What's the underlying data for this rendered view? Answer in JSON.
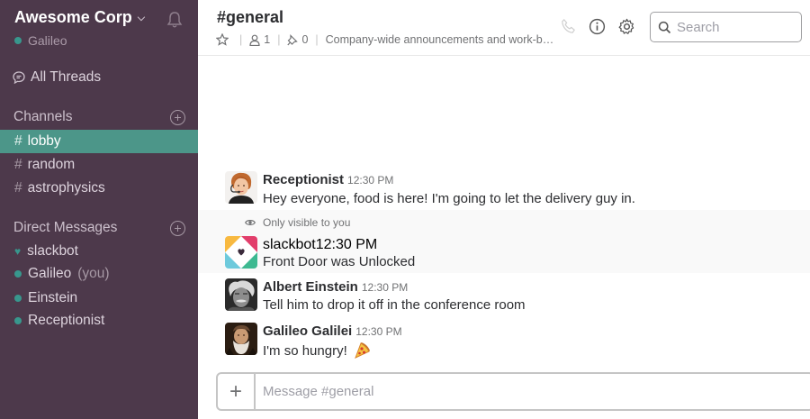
{
  "sidebar": {
    "team_name": "Awesome Corp",
    "current_user": "Galileo",
    "all_threads": "All Threads",
    "channels_header": "Channels",
    "channels": [
      {
        "name": "lobby",
        "active": true
      },
      {
        "name": "random",
        "active": false
      },
      {
        "name": "astrophysics",
        "active": false
      }
    ],
    "dm_header": "Direct Messages",
    "dms": [
      {
        "name": "slackbot",
        "suffix": "",
        "status": "heart"
      },
      {
        "name": "Galileo",
        "suffix": "(you)",
        "status": "online"
      },
      {
        "name": "Einstein",
        "suffix": "",
        "status": "online"
      },
      {
        "name": "Receptionist",
        "suffix": "",
        "status": "online"
      }
    ]
  },
  "header": {
    "channel": "#general",
    "members": "1",
    "pins": "0",
    "topic": "Company-wide announcements and work-b…",
    "search_placeholder": "Search"
  },
  "messages": [
    {
      "author": "Receptionist",
      "time": "12:30 PM",
      "text": "Hey everyone, food is here! I'm going to let the delivery guy in."
    },
    {
      "author": "slackbot",
      "time": "12:30 PM",
      "text": "Front Door was Unlocked",
      "note": "Only visible to you"
    },
    {
      "author": "Albert Einstein",
      "time": "12:30 PM",
      "text": "Tell him to drop it off in the conference room"
    },
    {
      "author": "Galileo Galilei",
      "time": "12:30 PM",
      "text": "I'm so hungry!",
      "emoji": "🍕"
    }
  ],
  "composer": {
    "placeholder": "Message #general"
  },
  "colors": {
    "sidebar": "#4d394b",
    "active_channel": "#4c9689",
    "presence": "#38978d"
  }
}
